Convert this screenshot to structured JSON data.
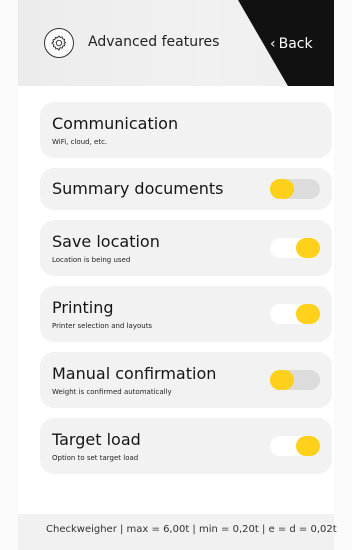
{
  "header": {
    "title": "Advanced features",
    "back_label": "Back",
    "gear_icon": "gear-icon",
    "back_icon": "chevron-left-icon"
  },
  "settings": [
    {
      "title": "Communication",
      "subtitle": "WiFi, cloud, etc.",
      "toggle": null
    },
    {
      "title": "Summary documents",
      "subtitle": "",
      "toggle": "off"
    },
    {
      "title": "Save location",
      "subtitle": "Location is being used",
      "toggle": "on"
    },
    {
      "title": "Printing",
      "subtitle": "Printer selection and layouts",
      "toggle": "on"
    },
    {
      "title": "Manual confirmation",
      "subtitle": "Weight is confirmed automatically",
      "toggle": "off"
    },
    {
      "title": "Target load",
      "subtitle": "Option to set target load",
      "toggle": "on"
    }
  ],
  "footer": {
    "text": "Checkweigher | max = 6,00t | min = 0,20t | e = d = 0,02t"
  },
  "colors": {
    "accent": "#ffd11a",
    "card": "#f2f2f2",
    "header_dark": "#111111"
  }
}
